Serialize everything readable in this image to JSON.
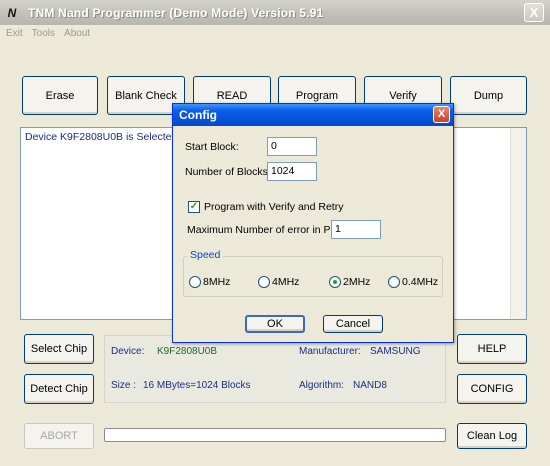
{
  "window": {
    "title": "TNM  Nand Programmer  (Demo Mode)  Version 5.91",
    "icon": "N",
    "close": "X"
  },
  "menu": [
    "Exit",
    "Tools",
    "About"
  ],
  "toolbar": {
    "erase": "Erase",
    "blank_check": "Blank  Check",
    "read": "READ",
    "program": "Program",
    "verify": "Verify",
    "dump": "Dump"
  },
  "log": {
    "line1": "Device K9F2808U0B is Selected."
  },
  "left_buttons": {
    "select_chip": "Select Chip",
    "detect_chip": "Detect Chip",
    "abort": "ABORT"
  },
  "right_buttons": {
    "help": "HELP",
    "config": "CONFIG",
    "clean_log": "Clean Log"
  },
  "info": {
    "device_label": "Device:",
    "device_value": "K9F2808U0B",
    "manufacturer_label": "Manufacturer:",
    "manufacturer_value": "SAMSUNG",
    "size_label": "Size :",
    "size_value": "16 MBytes=1024 Blocks",
    "algorithm_label": "Algorithm:",
    "algorithm_value": "NAND8"
  },
  "progress": {
    "value": 0
  },
  "dialog": {
    "title": "Config",
    "close": "X",
    "start_block_label": "Start Block:",
    "start_block_value": "0",
    "num_blocks_label": "Number of Blocks:",
    "num_blocks_value": "1024",
    "verify_retry_label": "Program with Verify and Retry",
    "verify_retry_checked": true,
    "max_errors_label": "Maximum Number of error in Page:",
    "max_errors_value": "1",
    "speed_title": "Speed",
    "speeds": [
      "8MHz",
      "4MHz",
      "2MHz",
      "0.4MHz"
    ],
    "speed_selected": "2MHz",
    "ok": "OK",
    "cancel": "Cancel"
  },
  "colors": {
    "dialog_title": "#0553db",
    "log_text": "#1a2d86",
    "device_value": "#1d6b1d"
  }
}
